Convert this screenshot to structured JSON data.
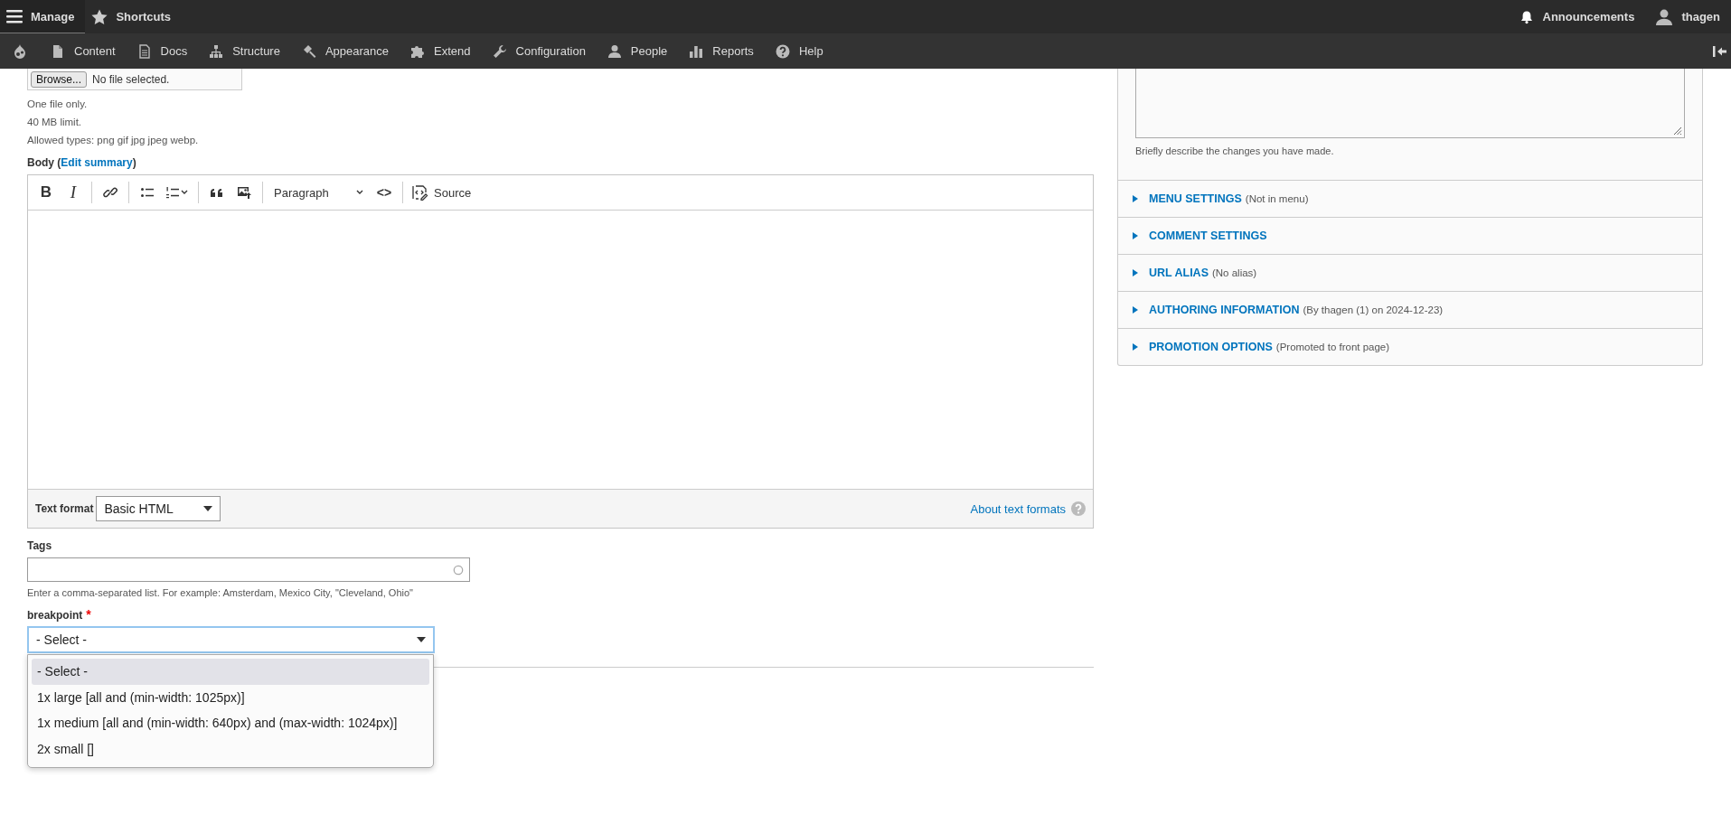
{
  "toolbar": {
    "tabs": [
      {
        "label": "Manage",
        "selected": true
      },
      {
        "label": "Shortcuts",
        "selected": false
      }
    ],
    "user_items": [
      {
        "label": "Announcements"
      },
      {
        "label": "thagen"
      }
    ],
    "menu": [
      {
        "label": "Content"
      },
      {
        "label": "Docs"
      },
      {
        "label": "Structure"
      },
      {
        "label": "Appearance"
      },
      {
        "label": "Extend"
      },
      {
        "label": "Configuration"
      },
      {
        "label": "People"
      },
      {
        "label": "Reports"
      },
      {
        "label": "Help"
      }
    ]
  },
  "image_field": {
    "button": "Browse...",
    "status": "No file selected.",
    "help": [
      "One file only.",
      "40 MB limit.",
      "Allowed types: png gif jpg jpeg webp."
    ]
  },
  "body": {
    "label_prefix": "Body (",
    "link": "Edit summary",
    "label_suffix": ")",
    "editor": {
      "bold": "B",
      "italic": "I",
      "heading": "Paragraph",
      "code": "<>",
      "source": "Source"
    },
    "text_format": {
      "label": "Text format",
      "value": "Basic HTML",
      "about_link": "About text formats"
    }
  },
  "tags": {
    "label": "Tags",
    "description": "Enter a comma-separated list. For example: Amsterdam, Mexico City, \"Cleveland, Ohio\""
  },
  "breakpoint": {
    "label": "breakpoint",
    "required_mark": "*",
    "value": "- Select -",
    "expanded": true,
    "options": [
      {
        "label": "- Select -",
        "selected": true
      },
      {
        "label": "1x large [all and (min-width: 1025px)]",
        "selected": false
      },
      {
        "label": "1x medium [all and (min-width: 640px) and (max-width: 1024px)]",
        "selected": false
      },
      {
        "label": "2x small []",
        "selected": false
      }
    ]
  },
  "sidebar": {
    "revision_description": "Briefly describe the changes you have made.",
    "sections": [
      {
        "title": "MENU SETTINGS",
        "summary": "(Not in menu)",
        "expanded": false
      },
      {
        "title": "COMMENT SETTINGS",
        "expanded": false
      },
      {
        "title": "URL ALIAS",
        "summary": "(No alias)",
        "expanded": false
      },
      {
        "title": "AUTHORING INFORMATION",
        "summary": "(By thagen (1) on 2024-12-23)",
        "expanded": false
      },
      {
        "title": "PROMOTION OPTIONS",
        "summary": "(Promoted to front page)",
        "expanded": false
      }
    ]
  }
}
